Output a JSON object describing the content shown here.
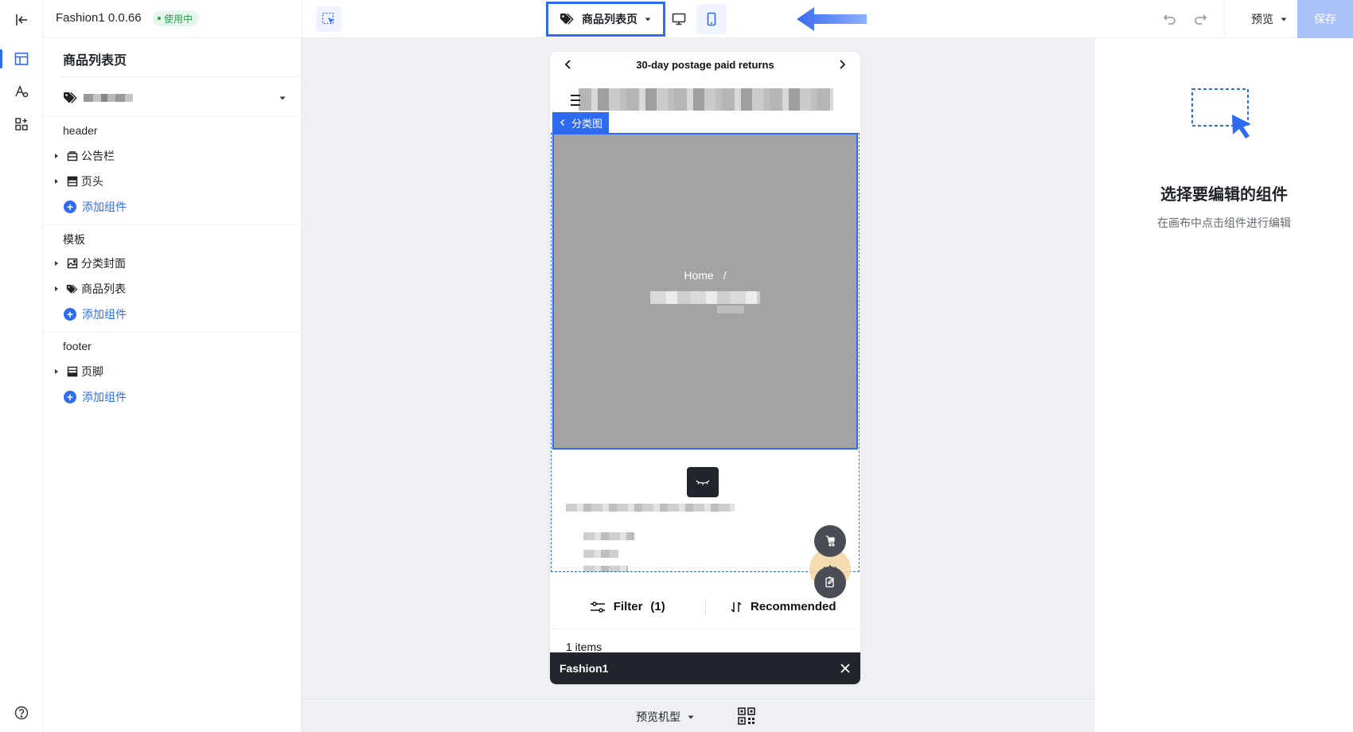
{
  "app": {
    "name": "Fashion1 0.0.66",
    "status": "使用中"
  },
  "toolbar": {
    "page_select": "商品列表页",
    "preview_label": "预览",
    "save_label": "保存"
  },
  "tree": {
    "panel_title": "商品列表页",
    "sections": [
      {
        "label": "header",
        "items": [
          "公告栏",
          "页头"
        ],
        "add_label": "添加组件"
      },
      {
        "label": "模板",
        "items": [
          "分类封面",
          "商品列表"
        ],
        "add_label": "添加组件"
      },
      {
        "label": "footer",
        "items": [
          "页脚"
        ],
        "add_label": "添加组件"
      }
    ]
  },
  "canvas": {
    "announcement": "30-day postage paid returns",
    "selected_component_tag": "分类图",
    "breadcrumb_home": "Home",
    "breadcrumb_sep": "/",
    "filter_label": "Filter",
    "filter_count": "(1)",
    "sort_label": "Recommended",
    "items_count": "1 items",
    "toast_title": "Fashion1",
    "device_model_label": "预览机型"
  },
  "inspector": {
    "empty_title": "选择要编辑的组件",
    "empty_desc": "在画布中点击组件进行编辑"
  },
  "colors": {
    "accent": "#2f6bf0",
    "save_disabled": "#a9c1f7",
    "canvas_bg": "#eef0f4",
    "banner_gray": "#a3a3a3",
    "status_green": "#2b9b52"
  }
}
